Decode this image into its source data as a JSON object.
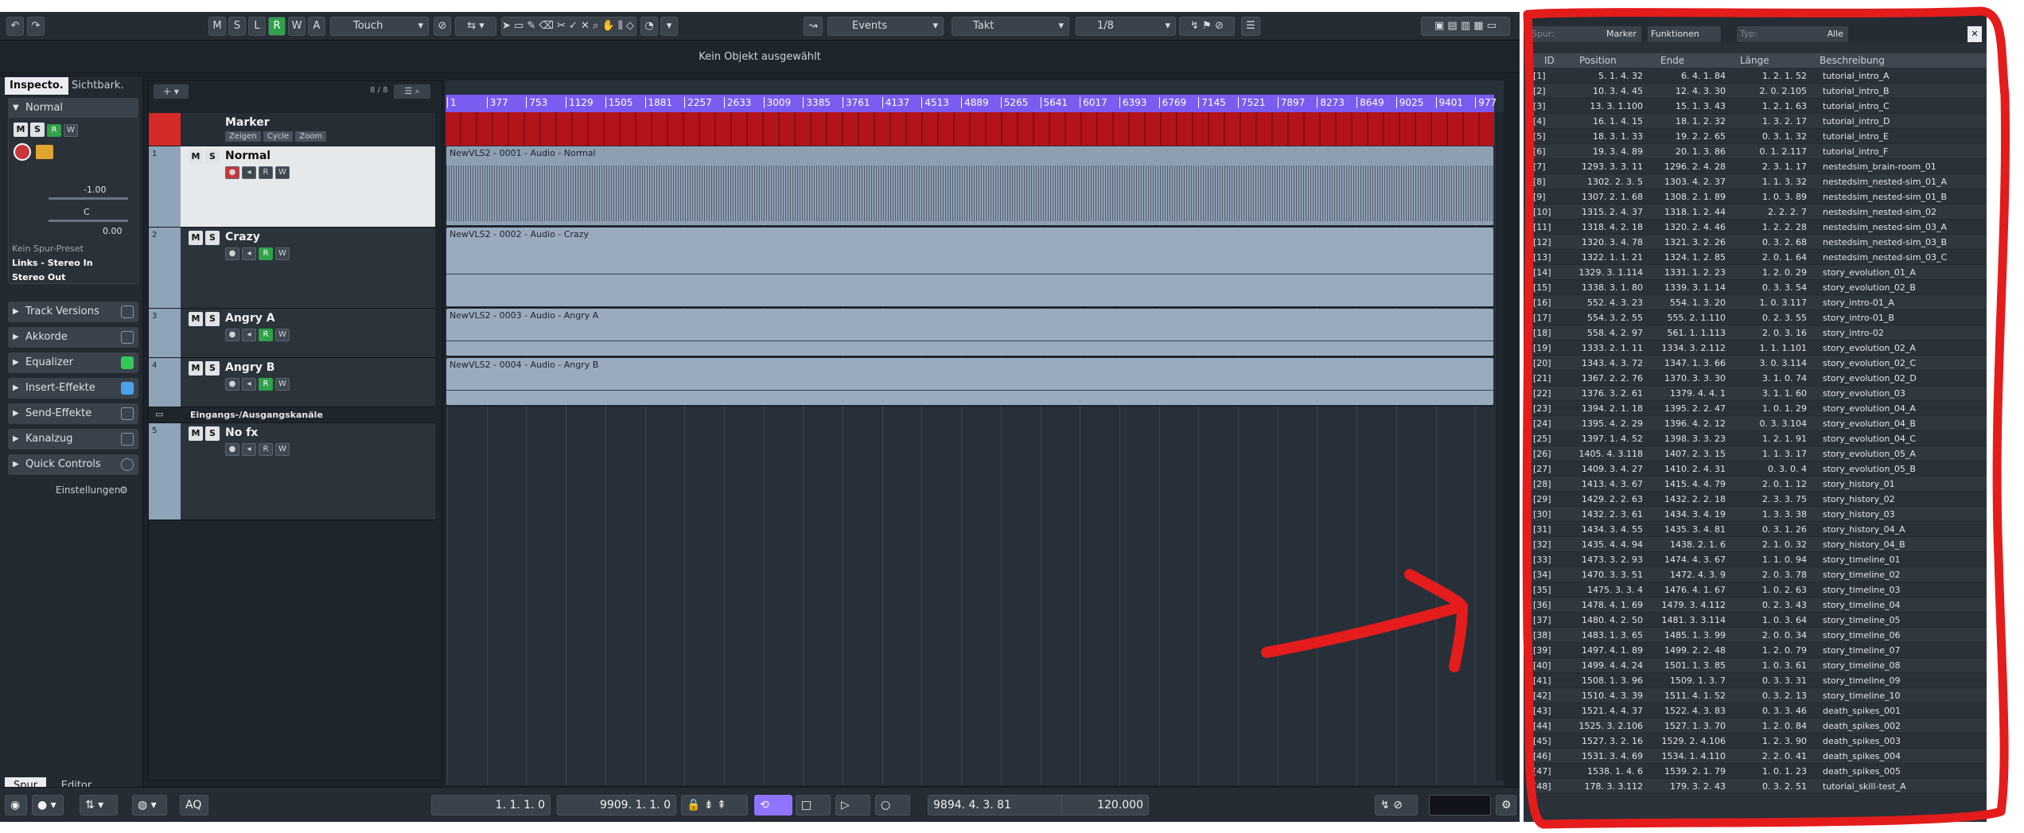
{
  "toolbar": {
    "buttons": [
      "M",
      "S",
      "L",
      "R",
      "W",
      "A"
    ],
    "automation_mode": "Touch",
    "events_label": "Events",
    "grid_type": "Takt",
    "quantize": "1/8"
  },
  "infobar": {
    "message": "Kein Objekt ausgewählt"
  },
  "inspector": {
    "tabs": [
      "Inspecto.",
      "Sichtbark."
    ],
    "track_name": "Normal",
    "volume": "-1.00",
    "pan": "C",
    "delay": "0.00",
    "preset": "Kein Spur-Preset",
    "input": "Links - Stereo In",
    "output": "Stereo Out",
    "panels": [
      "Track Versions",
      "Akkorde",
      "Equalizer",
      "Insert-Effekte",
      "Send-Effekte",
      "Kanalzug",
      "Quick Controls"
    ],
    "settings": "Einstellungen",
    "bottom_tabs": [
      "Spur",
      "Editor"
    ]
  },
  "tracklist": {
    "count": "8 / 8",
    "marker": {
      "name": "Marker",
      "buttons": [
        "Zeigen",
        "Cycle",
        "Zoom"
      ]
    },
    "tracks": [
      {
        "num": "1",
        "name": "Normal"
      },
      {
        "num": "2",
        "name": "Crazy"
      },
      {
        "num": "3",
        "name": "Angry A"
      },
      {
        "num": "4",
        "name": "Angry B"
      }
    ],
    "folder": "Eingangs-/Ausgangskanäle",
    "notrack": {
      "num": "5",
      "name": "No fx"
    }
  },
  "ruler": [
    "1",
    "377",
    "753",
    "1129",
    "1505",
    "1881",
    "2257",
    "2633",
    "3009",
    "3385",
    "3761",
    "4137",
    "4513",
    "4889",
    "5265",
    "5641",
    "6017",
    "6393",
    "6769",
    "7145",
    "7521",
    "7897",
    "8273",
    "8649",
    "9025",
    "9401",
    "977"
  ],
  "clips": [
    "NewVLS2 - 0001 - Audio - Normal",
    "NewVLS2 - 0002 - Audio - Crazy",
    "NewVLS2 - 0003 - Audio - Angry A",
    "NewVLS2 - 0004 - Audio - Angry B"
  ],
  "transport": {
    "left_locator": "1. 1. 1.   0",
    "right_locator": "9909. 1. 1.   0",
    "position": "9894. 4. 3. 81",
    "tempo": "120.000",
    "aq": "AQ"
  },
  "marker_window": {
    "spur_label": "Spur:",
    "spur_value": "Marker",
    "functions": "Funktionen",
    "typ_label": "Typ:",
    "typ_value": "Alle",
    "headers": [
      "ID",
      "Position",
      "Ende",
      "Länge",
      "Beschreibung"
    ],
    "rows": [
      [
        "[1]",
        "5. 1. 4. 32",
        "6. 4. 1. 84",
        "1. 2. 1. 52",
        "tutorial_intro_A"
      ],
      [
        "[2]",
        "10. 3. 4. 45",
        "12. 4. 3. 30",
        "2. 0. 2.105",
        "tutorial_intro_B"
      ],
      [
        "[3]",
        "13. 3. 1.100",
        "15. 1. 3. 43",
        "1. 2. 1. 63",
        "tutorial_intro_C"
      ],
      [
        "[4]",
        "16. 1. 4. 15",
        "18. 1. 2. 32",
        "1. 3. 2. 17",
        "tutorial_intro_D"
      ],
      [
        "[5]",
        "18. 3. 1. 33",
        "19. 2. 2. 65",
        "0. 3. 1. 32",
        "tutorial_intro_E"
      ],
      [
        "[6]",
        "19. 3. 4. 89",
        "20. 1. 3. 86",
        "0. 1. 2.117",
        "tutorial_intro_F"
      ],
      [
        "[7]",
        "1293. 3. 3. 11",
        "1296. 2. 4. 28",
        "2. 3. 1. 17",
        "nestedsim_brain-room_01"
      ],
      [
        "[8]",
        "1302. 2. 3. 5",
        "1303. 4. 2. 37",
        "1. 1. 3. 32",
        "nestedsim_nested-sim_01_A"
      ],
      [
        "[9]",
        "1307. 2. 1. 68",
        "1308. 2. 1. 89",
        "1. 0. 3. 89",
        "nestedsim_nested-sim_01_B"
      ],
      [
        "[10]",
        "1315. 2. 4. 37",
        "1318. 1. 2. 44",
        "2. 2. 2. 7",
        "nestedsim_nested-sim_02"
      ],
      [
        "[11]",
        "1318. 4. 2. 18",
        "1320. 2. 4. 46",
        "1. 2. 2. 28",
        "nestedsim_nested-sim_03_A"
      ],
      [
        "[12]",
        "1320. 3. 4. 78",
        "1321. 3. 2. 26",
        "0. 3. 2. 68",
        "nestedsim_nested-sim_03_B"
      ],
      [
        "[13]",
        "1322. 1. 1. 21",
        "1324. 1. 2. 85",
        "2. 0. 1. 64",
        "nestedsim_nested-sim_03_C"
      ],
      [
        "[14]",
        "1329. 3. 1.114",
        "1331. 1. 2. 23",
        "1. 2. 0. 29",
        "story_evolution_01_A"
      ],
      [
        "[15]",
        "1338. 3. 1. 80",
        "1339. 3. 1. 14",
        "0. 3. 3. 54",
        "story_evolution_02_B"
      ],
      [
        "[16]",
        "552. 4. 3. 23",
        "554. 1. 3. 20",
        "1. 0. 3.117",
        "story_intro-01_A"
      ],
      [
        "[17]",
        "554. 3. 2. 55",
        "555. 2. 1.110",
        "0. 2. 3. 55",
        "story_intro-01_B"
      ],
      [
        "[18]",
        "558. 4. 2. 97",
        "561. 1. 1.113",
        "2. 0. 3. 16",
        "story_intro-02"
      ],
      [
        "[19]",
        "1333. 2. 1. 11",
        "1334. 3. 2.112",
        "1. 1. 1.101",
        "story_evolution_02_A"
      ],
      [
        "[20]",
        "1343. 4. 3. 72",
        "1347. 1. 3. 66",
        "3. 0. 3.114",
        "story_evolution_02_C"
      ],
      [
        "[21]",
        "1367. 2. 2. 76",
        "1370. 3. 3. 30",
        "3. 1. 0. 74",
        "story_evolution_02_D"
      ],
      [
        "[22]",
        "1376. 3. 2. 61",
        "1379. 4. 4. 1",
        "3. 1. 1. 60",
        "story_evolution_03"
      ],
      [
        "[23]",
        "1394. 2. 1. 18",
        "1395. 2. 2. 47",
        "1. 0. 1. 29",
        "story_evolution_04_A"
      ],
      [
        "[24]",
        "1395. 4. 2. 29",
        "1396. 4. 2. 12",
        "0. 3. 3.104",
        "story_evolution_04_B"
      ],
      [
        "[25]",
        "1397. 1. 4. 52",
        "1398. 3. 3. 23",
        "1. 2. 1. 91",
        "story_evolution_04_C"
      ],
      [
        "[26]",
        "1405. 4. 3.118",
        "1407. 2. 3. 15",
        "1. 1. 3. 17",
        "story_evolution_05_A"
      ],
      [
        "[27]",
        "1409. 3. 4. 27",
        "1410. 2. 4. 31",
        "0. 3. 0. 4",
        "story_evolution_05_B"
      ],
      [
        "[28]",
        "1413. 4. 3. 67",
        "1415. 4. 4. 79",
        "2. 0. 1. 12",
        "story_history_01"
      ],
      [
        "[29]",
        "1429. 2. 2. 63",
        "1432. 2. 2. 18",
        "2. 3. 3. 75",
        "story_history_02"
      ],
      [
        "[30]",
        "1432. 2. 3. 61",
        "1434. 3. 4. 19",
        "1. 3. 3. 38",
        "story_history_03"
      ],
      [
        "[31]",
        "1434. 3. 4. 55",
        "1435. 3. 4. 81",
        "0. 3. 1. 26",
        "story_history_04_A"
      ],
      [
        "[32]",
        "1435. 4. 4. 94",
        "1438. 2. 1. 6",
        "2. 1. 0. 32",
        "story_history_04_B"
      ],
      [
        "[33]",
        "1473. 3. 2. 93",
        "1474. 4. 3. 67",
        "1. 1. 0. 94",
        "story_timeline_01"
      ],
      [
        "[34]",
        "1470. 3. 3. 51",
        "1472. 4. 3. 9",
        "2. 0. 3. 78",
        "story_timeline_02"
      ],
      [
        "[35]",
        "1475. 3. 3. 4",
        "1476. 4. 1. 67",
        "1. 0. 2. 63",
        "story_timeline_03"
      ],
      [
        "[36]",
        "1478. 4. 1. 69",
        "1479. 3. 4.112",
        "0. 2. 3. 43",
        "story_timeline_04"
      ],
      [
        "[37]",
        "1480. 4. 2. 50",
        "1481. 3. 3.114",
        "1. 0. 3. 64",
        "story_timeline_05"
      ],
      [
        "[38]",
        "1483. 1. 3. 65",
        "1485. 1. 3. 99",
        "2. 0. 0. 34",
        "story_timeline_06"
      ],
      [
        "[39]",
        "1497. 4. 1. 89",
        "1499. 2. 2. 48",
        "1. 2. 0. 79",
        "story_timeline_07"
      ],
      [
        "[40]",
        "1499. 4. 4. 24",
        "1501. 1. 3. 85",
        "1. 0. 3. 61",
        "story_timeline_08"
      ],
      [
        "[41]",
        "1508. 1. 3. 96",
        "1509. 1. 3. 7",
        "0. 3. 3. 31",
        "story_timeline_09"
      ],
      [
        "[42]",
        "1510. 4. 3. 39",
        "1511. 4. 1. 52",
        "0. 3. 2. 13",
        "story_timeline_10"
      ],
      [
        "[43]",
        "1521. 4. 4. 37",
        "1522. 4. 3. 83",
        "0. 3. 3. 46",
        "death_spikes_001"
      ],
      [
        "[44]",
        "1525. 3. 2.106",
        "1527. 1. 3. 70",
        "1. 2. 0. 84",
        "death_spikes_002"
      ],
      [
        "[45]",
        "1527. 3. 2. 16",
        "1529. 2. 4.106",
        "1. 2. 3. 90",
        "death_spikes_003"
      ],
      [
        "[46]",
        "1531. 3. 4. 69",
        "1534. 1. 4.110",
        "2. 2. 0. 41",
        "death_spikes_004"
      ],
      [
        "[47]",
        "1538. 1. 4. 6",
        "1539. 2. 1. 79",
        "1. 0. 1. 23",
        "death_spikes_005"
      ],
      [
        "[48]",
        "178. 3. 3.112",
        "179. 3. 2. 43",
        "0. 3. 2. 51",
        "tutorial_skill-test_A"
      ]
    ]
  },
  "colors": {
    "accent": "#8f74ff",
    "record": "#c8363a",
    "marker_track": "#b3131a",
    "annotation": "#e41c1c",
    "green": "#2fa24a"
  }
}
